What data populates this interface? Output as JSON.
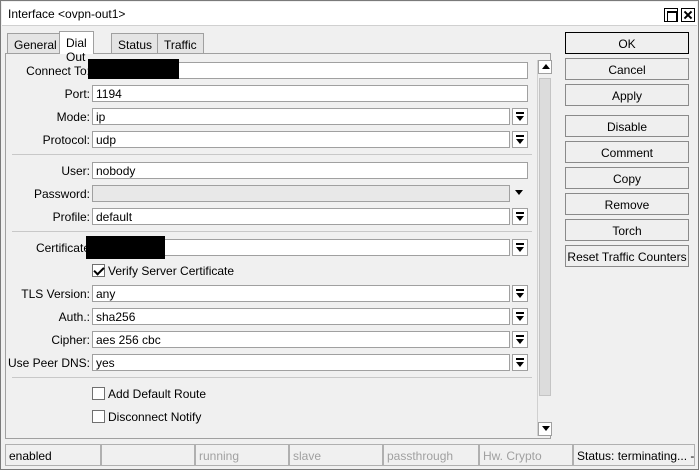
{
  "window": {
    "title": "Interface <ovpn-out1>"
  },
  "tabs": [
    "General",
    "Dial Out",
    "Status",
    "Traffic"
  ],
  "form": {
    "connect_to_label": "Connect To:",
    "connect_to_value": "",
    "port_label": "Port:",
    "port_value": "1194",
    "mode_label": "Mode:",
    "mode_value": "ip",
    "protocol_label": "Protocol:",
    "protocol_value": "udp",
    "user_label": "User:",
    "user_value": "nobody",
    "password_label": "Password:",
    "password_value": "",
    "profile_label": "Profile:",
    "profile_value": "default",
    "certificate_label": "Certificate",
    "certificate_value": "",
    "verify_label": "Verify Server Certificate",
    "verify_checked": true,
    "tls_label": "TLS Version:",
    "tls_value": "any",
    "auth_label": "Auth.:",
    "auth_value": "sha256",
    "cipher_label": "Cipher:",
    "cipher_value": "aes 256 cbc",
    "peer_dns_label": "Use Peer DNS:",
    "peer_dns_value": "yes",
    "default_route_label": "Add Default Route",
    "default_route_checked": false,
    "disconnect_notify_label": "Disconnect Notify",
    "disconnect_notify_checked": false
  },
  "buttons": {
    "ok": "OK",
    "cancel": "Cancel",
    "apply": "Apply",
    "disable": "Disable",
    "comment": "Comment",
    "copy": "Copy",
    "remove": "Remove",
    "torch": "Torch",
    "reset": "Reset Traffic Counters"
  },
  "statusbar": {
    "enabled": "enabled",
    "blank": "",
    "running": "running",
    "slave": "slave",
    "passthrough": "passthrough",
    "hw_crypto": "Hw. Crypto",
    "status": "Status: terminating... -"
  }
}
